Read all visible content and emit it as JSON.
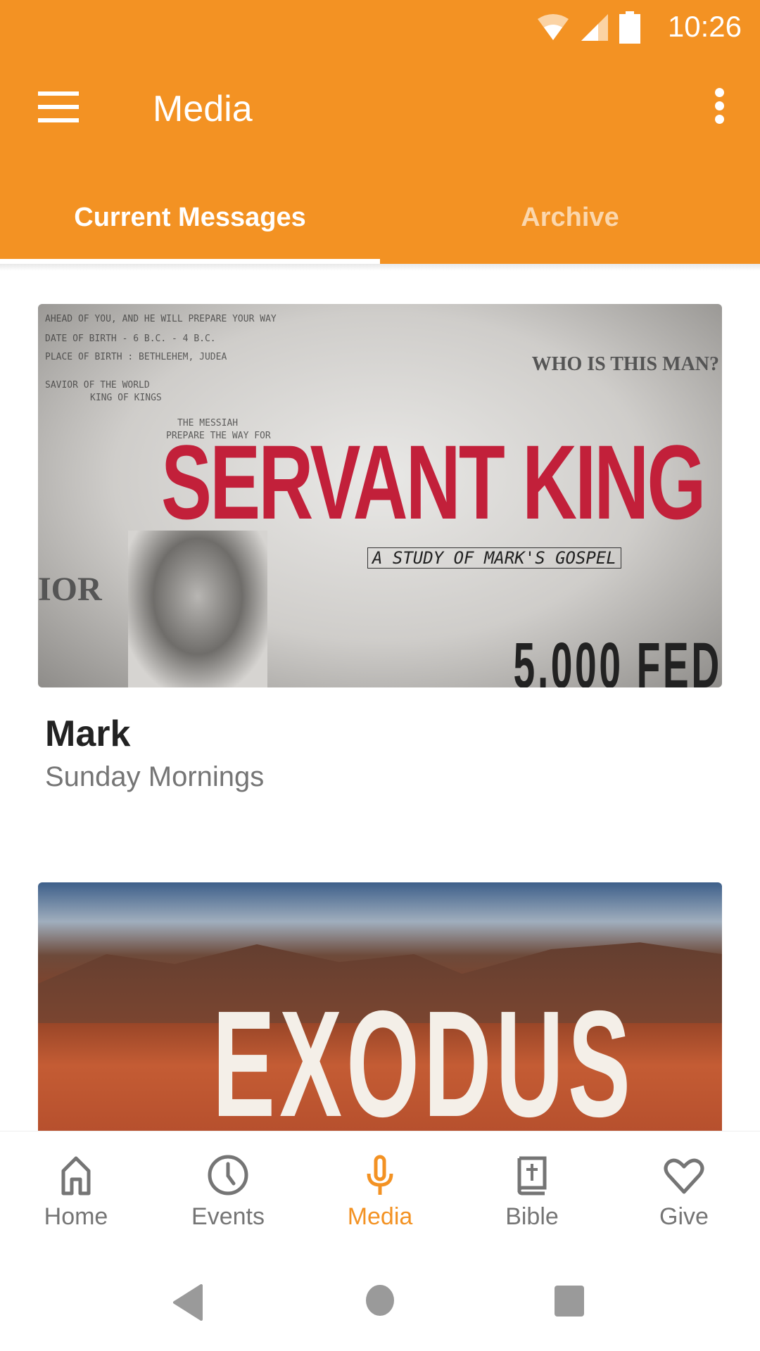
{
  "status_bar": {
    "time": "10:26",
    "icons": [
      "wifi-icon",
      "signal-icon",
      "battery-icon"
    ]
  },
  "toolbar": {
    "title": "Media",
    "menu_icon": "hamburger-menu-icon",
    "more_icon": "more-vert-icon"
  },
  "tabs": [
    {
      "label": "Current Messages",
      "active": true
    },
    {
      "label": "Archive",
      "active": false
    }
  ],
  "series": [
    {
      "title": "Mark",
      "subtitle": "Sunday Mornings",
      "artwork": {
        "headline": "SERVANT KING",
        "tagline": "A STUDY OF MARK'S GOSPEL",
        "corner_text": "WHO IS THIS MAN?",
        "side_text": "IOR",
        "bottom_text": "5,000 FED",
        "notes": [
          "AHEAD OF YOU, AND HE WILL PREPARE YOUR WAY",
          "DATE OF BIRTH - 6 B.C. - 4 B.C.",
          "PLACE OF BIRTH : BETHLEHEM, JUDEA",
          "SAVIOR OF THE WORLD",
          "KING OF KINGS",
          "THE MESSIAH",
          "PREPARE THE WAY FOR"
        ]
      }
    },
    {
      "artwork": {
        "headline": "EXODUS"
      }
    }
  ],
  "bottom_nav": [
    {
      "label": "Home",
      "icon": "home-icon",
      "active": false
    },
    {
      "label": "Events",
      "icon": "clock-icon",
      "active": false
    },
    {
      "label": "Media",
      "icon": "microphone-icon",
      "active": true
    },
    {
      "label": "Bible",
      "icon": "bible-icon",
      "active": false
    },
    {
      "label": "Give",
      "icon": "heart-icon",
      "active": false
    }
  ],
  "colors": {
    "accent": "#f39223",
    "inactive_icon": "#757575",
    "title_text": "#222222"
  }
}
